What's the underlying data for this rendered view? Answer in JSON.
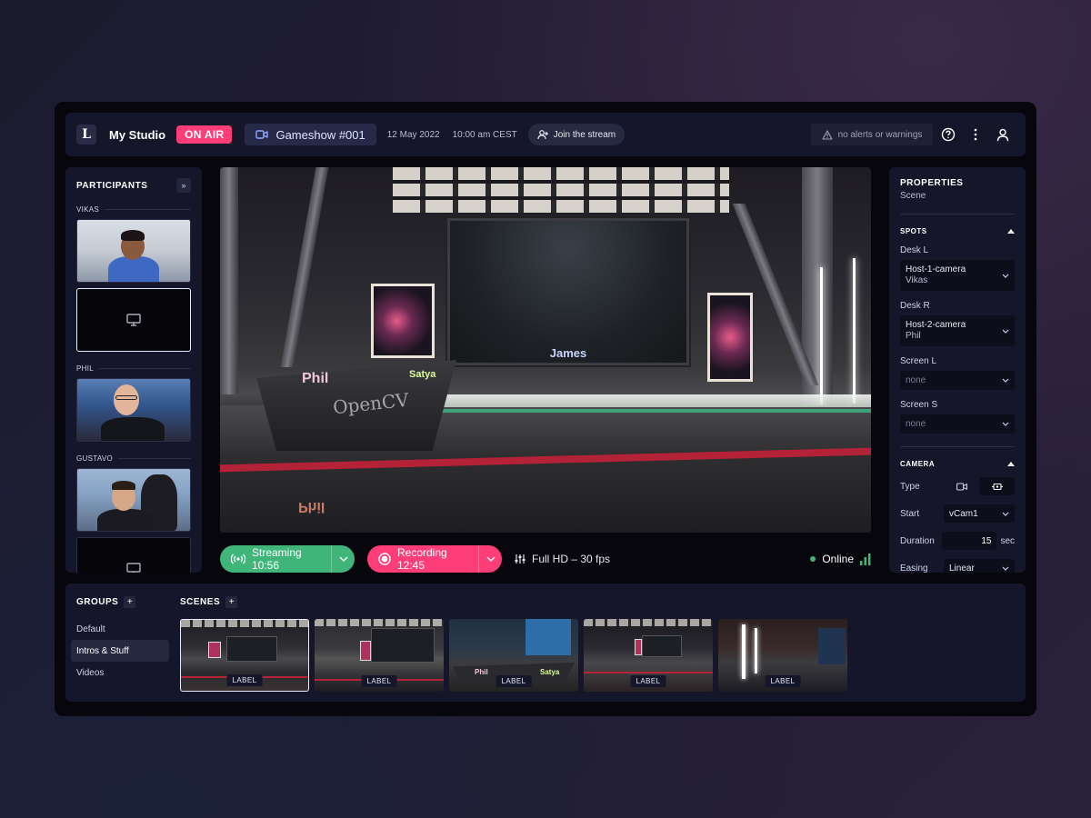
{
  "topbar": {
    "logo_glyph": "L",
    "studio_name": "My Studio",
    "on_air": "ON AIR",
    "show_title": "Gameshow #001",
    "date": "12 May 2022",
    "time": "10:00 am CEST",
    "join_label": "Join the stream",
    "alerts": "no alerts or warnings"
  },
  "participants": {
    "title": "PARTICIPANTS",
    "people": [
      {
        "name": "VIKAS"
      },
      {
        "name": "PHIL"
      },
      {
        "name": "GUSTAVO"
      }
    ]
  },
  "stage": {
    "screen_name": "James",
    "desk_left_name": "Phil",
    "desk_right_name": "Satya",
    "desk_brand": "OpenCV"
  },
  "controls": {
    "streaming": "Streaming 10:56",
    "recording": "Recording 12:45",
    "quality": "Full HD – 30 fps",
    "status": "Online"
  },
  "properties": {
    "title": "PROPERTIES",
    "subtitle": "Scene",
    "spots": {
      "title": "SPOTS",
      "desk_l": {
        "label": "Desk L",
        "value": "Host-1-camera",
        "sub": "Vikas"
      },
      "desk_r": {
        "label": "Desk R",
        "value": "Host-2-camera",
        "sub": "Phil"
      },
      "screen_l": {
        "label": "Screen L",
        "value": "none"
      },
      "screen_s": {
        "label": "Screen S",
        "value": "none"
      }
    },
    "camera": {
      "title": "CAMERA",
      "type_label": "Type",
      "start_label": "Start",
      "start_value": "vCam1",
      "duration_label": "Duration",
      "duration_value": "15",
      "duration_unit": "sec",
      "easing_label": "Easing",
      "easing_value": "Linear"
    }
  },
  "groups": {
    "title": "GROUPS",
    "items": [
      "Default",
      "Intros & Stuff",
      "Videos"
    ],
    "active_index": 1
  },
  "scenes": {
    "title": "SCENES",
    "items": [
      {
        "label": "LABEL"
      },
      {
        "label": "LABEL"
      },
      {
        "label": "LABEL",
        "desk_left": "Phil",
        "desk_right": "Satya"
      },
      {
        "label": "LABEL"
      },
      {
        "label": "LABEL"
      }
    ]
  },
  "colors": {
    "accent_on_air": "#ff3d78",
    "stream_green": "#3fb57a",
    "panel_bg": "#15162a"
  }
}
